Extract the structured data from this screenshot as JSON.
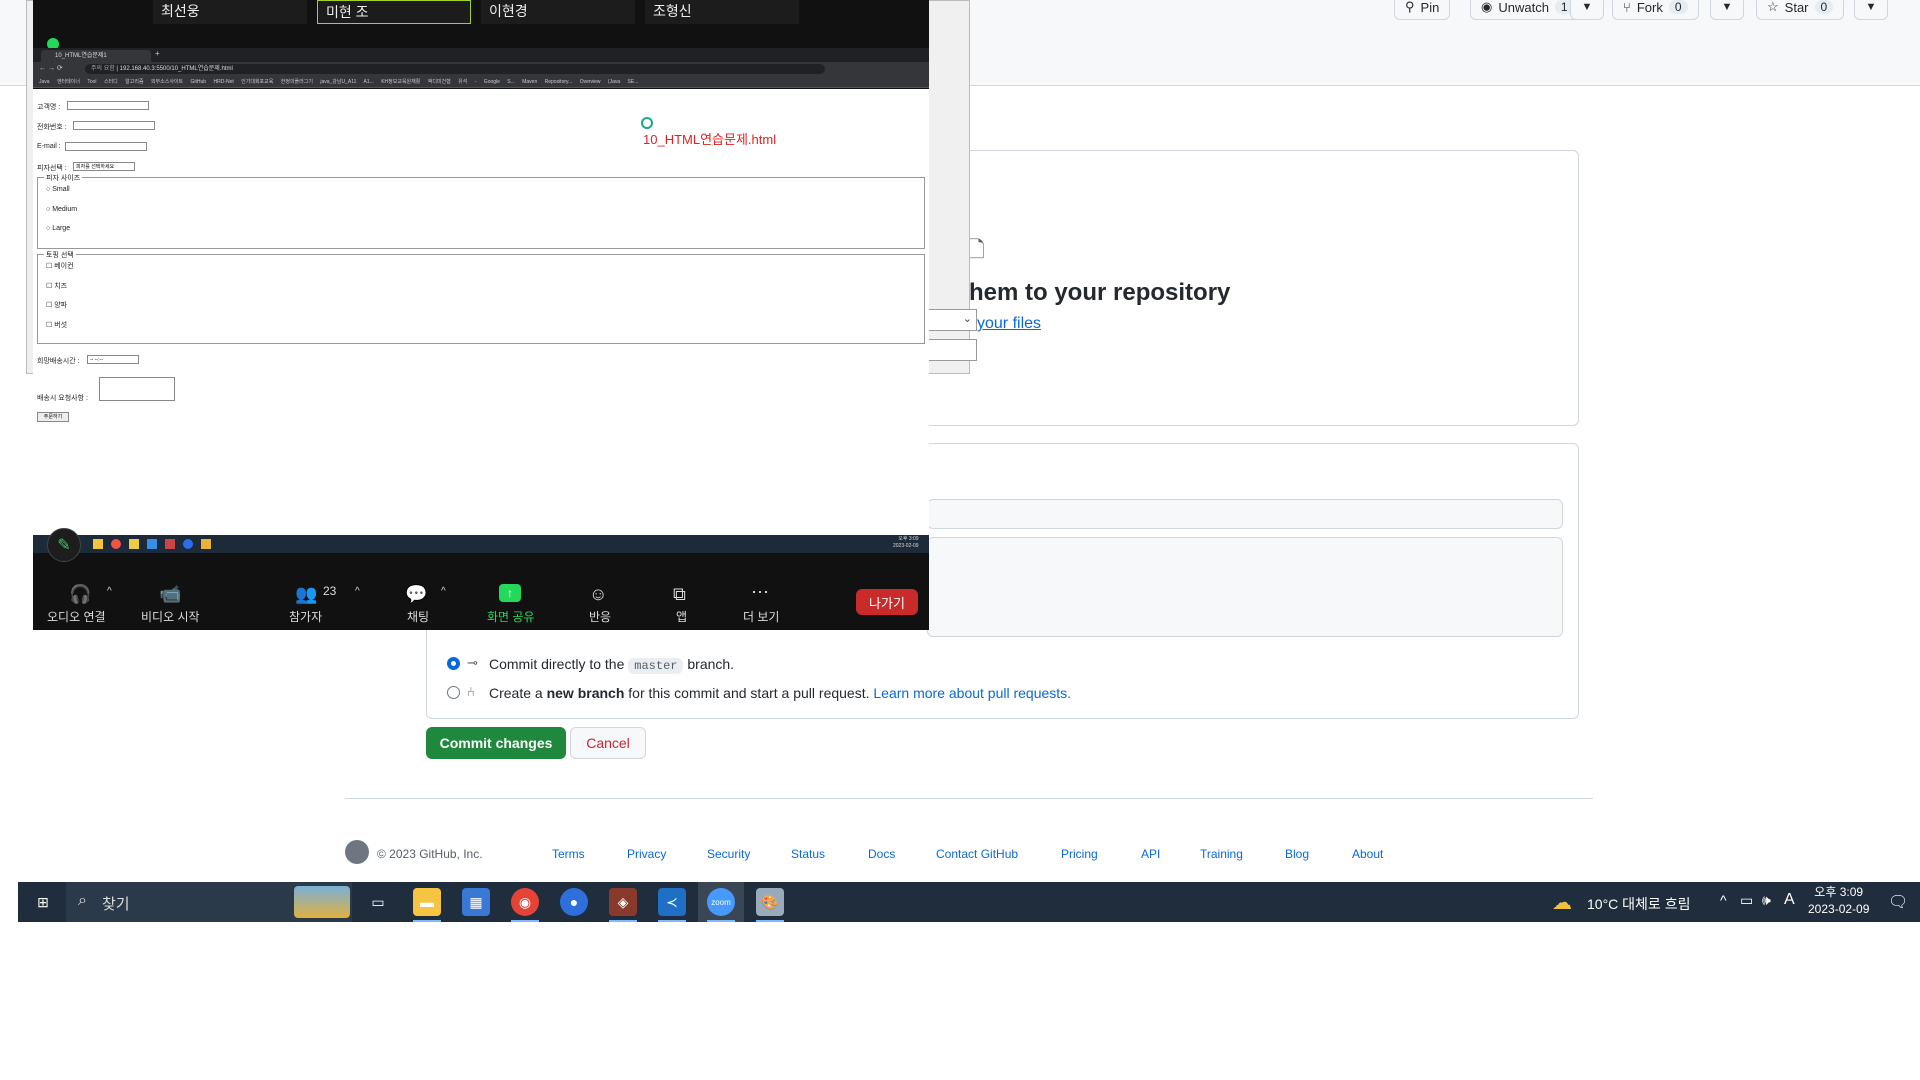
{
  "github": {
    "top_buttons": {
      "pin": "Pin",
      "unwatch": "Unwatch",
      "unwatch_count": "1",
      "fork": "Fork",
      "fork_count": "0",
      "star": "Star",
      "star_count": "0"
    },
    "upload_heading": "hem to your repository",
    "choose_files_link": "your files",
    "commit_option_direct_pre": "Commit directly to the",
    "commit_option_direct_branch": "master",
    "commit_option_direct_post": "branch.",
    "commit_option_new_pre": "Create a",
    "commit_option_new_bold": "new branch",
    "commit_option_new_post": "for this commit and start a pull request.",
    "commit_option_new_link": "Learn more about pull requests.",
    "commit_button": "Commit changes",
    "cancel_button": "Cancel",
    "footer": {
      "copyright": "© 2023 GitHub, Inc.",
      "links": [
        "Terms",
        "Privacy",
        "Security",
        "Status",
        "Docs",
        "Contact GitHub",
        "Pricing",
        "API",
        "Training",
        "Blog",
        "About"
      ]
    }
  },
  "zoom": {
    "participant_names": [
      "최선웅",
      "미현 조",
      "이현경",
      "조형신"
    ],
    "browser": {
      "tab_title": "10_HTML연습문제1",
      "address": "192.168.40.3:5500/10_HTML연습문제.html",
      "address_warning": "주의 요함",
      "bookmarks": [
        "Java",
        "엔터테이너",
        "Tool",
        "스터디",
        "알고리즘",
        "외부소스사이트",
        "GitHub",
        "HRD-Net",
        "인기대회포교육",
        "한정의플러그기",
        "java_강남U_A11 A1...",
        "KH정보교육원재활",
        "액디미건협",
        "유석 - Google S...",
        "Maven Repository...",
        "Overview (Java SE..."
      ]
    },
    "form": {
      "customer_label": "고객명 :",
      "phone_label": "전화번호 :",
      "email_label": "E-mail :",
      "pizza_select_label": "피자선택 :",
      "pizza_select_value": "피자를 선택하세요",
      "size_legend": "피자 사이즈",
      "sizes": [
        "Small",
        "Medium",
        "Large"
      ],
      "topping_legend": "토핑 선택",
      "toppings": [
        "베이컨",
        "치즈",
        "양파",
        "버섯"
      ],
      "delivery_time_label": "희망배송시간 :",
      "delivery_time_value": "-- --:--",
      "request_label": "배송시 요청사항 :",
      "submit": "주문하기",
      "file_name": "10_HTML연습문제.html"
    },
    "inner_taskbar_time": "오후 3:09",
    "inner_taskbar_date": "2023-02-09",
    "controls": {
      "audio": "오디오 연결",
      "video": "비디오 시작",
      "participants": "참가자",
      "participant_count": "23",
      "chat": "채팅",
      "share": "화면 공유",
      "reactions": "반응",
      "apps": "앱",
      "more": "더 보기",
      "leave": "나가기"
    },
    "colors": {
      "share_green": "#23d959",
      "leave_red": "#c92a2a"
    }
  },
  "taskbar": {
    "search_placeholder": "찾기",
    "weather": "10°C 대체로 흐림",
    "ime": "A",
    "time": "오후 3:09",
    "date": "2023-02-09"
  },
  "colors": {
    "github_green": "#1f883d",
    "link_blue": "#0969da",
    "cancel_red": "#cf222e",
    "taskbar_bg": "#1f2d3d"
  }
}
